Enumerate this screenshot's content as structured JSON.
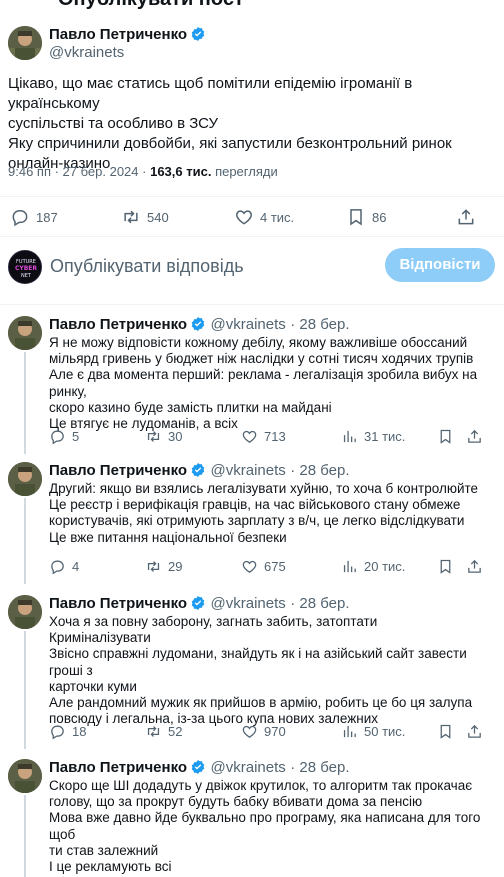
{
  "header": {
    "title": "Опублікувати пост"
  },
  "main_post": {
    "author": "Павло Петриченко",
    "handle": "@vkrainets",
    "lines": [
      "Цікаво, що має статись щоб помітили епідемію ігроманії в українському",
      "суспільстві та особливо в ЗСУ",
      "Яку спричинили довбойби, які запустили безконтрольний ринок",
      "онлайн-казино"
    ],
    "time": "9:46 пп · 27 бер. 2024 ·",
    "views_value": "163,6 тис.",
    "views_label": "перегляди",
    "replies": "187",
    "reposts": "540",
    "likes": "4 тис.",
    "bookmarks": "86"
  },
  "composer": {
    "avatar_text": [
      "FUTURE",
      "CYBER",
      "NET"
    ],
    "placeholder": "Опублікувати відповідь",
    "button": "Відповісти"
  },
  "replies": [
    {
      "author": "Павло Петриченко",
      "handle": "@vkrainets",
      "date": "· 28 бер.",
      "lines": [
        "Я не можу відповісти кожному дебілу, якому важливіше обоссаний",
        "мільярд гривень у бюджет ніж наслідки у сотні тисяч ходячих трупів",
        "Але є два момента перший: реклама - легалізація зробила вибух на ринку,",
        "скоро казино буде замість плитки на майдані",
        "Це втягує не лудоманів, а всіх"
      ],
      "replies": "5",
      "reposts": "30",
      "likes": "713",
      "views": "31 тис."
    },
    {
      "author": "Павло Петриченко",
      "handle": "@vkrainets",
      "date": "· 28 бер.",
      "lines": [
        "Другий: якщо ви взялись легалізувати хуйню, то хоча б контролюйте",
        "Це реєстр і верифікація гравців, на час військового стану обмеже",
        "користувачів, які отримують зарплату з в/ч, це легко відслідкувати",
        "Це вже питання національної безпеки"
      ],
      "replies": "4",
      "reposts": "29",
      "likes": "675",
      "views": "20 тис."
    },
    {
      "author": "Павло Петриченко",
      "handle": "@vkrainets",
      "date": "· 28 бер.",
      "lines": [
        "Хоча я за повну заборону, загнать забить, затоптати",
        "Криміналізувати",
        "Звісно справжні лудомани, знайдуть як і на азійський сайт завести гроші з",
        "карточки куми",
        "Але рандомний мужик як прийшов в армію, робить це бо ця залупа",
        "повсюду і легальна, із-за цього купа нових залежних"
      ],
      "replies": "18",
      "reposts": "52",
      "likes": "970",
      "views": "50 тис."
    },
    {
      "author": "Павло Петриченко",
      "handle": "@vkrainets",
      "date": "· 28 бер.",
      "lines": [
        "Скоро ще ШІ додадуть у двіжок крутилок, то алгоритм так прокачає",
        "голову, що за прокрут будуть бабку вбивати дома за пенсію",
        "Мова вже давно йде буквально про програму, яка написана для того щоб",
        "ти став залежний",
        "І це рекламують всі"
      ]
    }
  ],
  "colors": {
    "accent": "#1d9bf0",
    "reply_button": "#8ecdf8",
    "text": "#0f1419",
    "secondary": "#536471"
  }
}
